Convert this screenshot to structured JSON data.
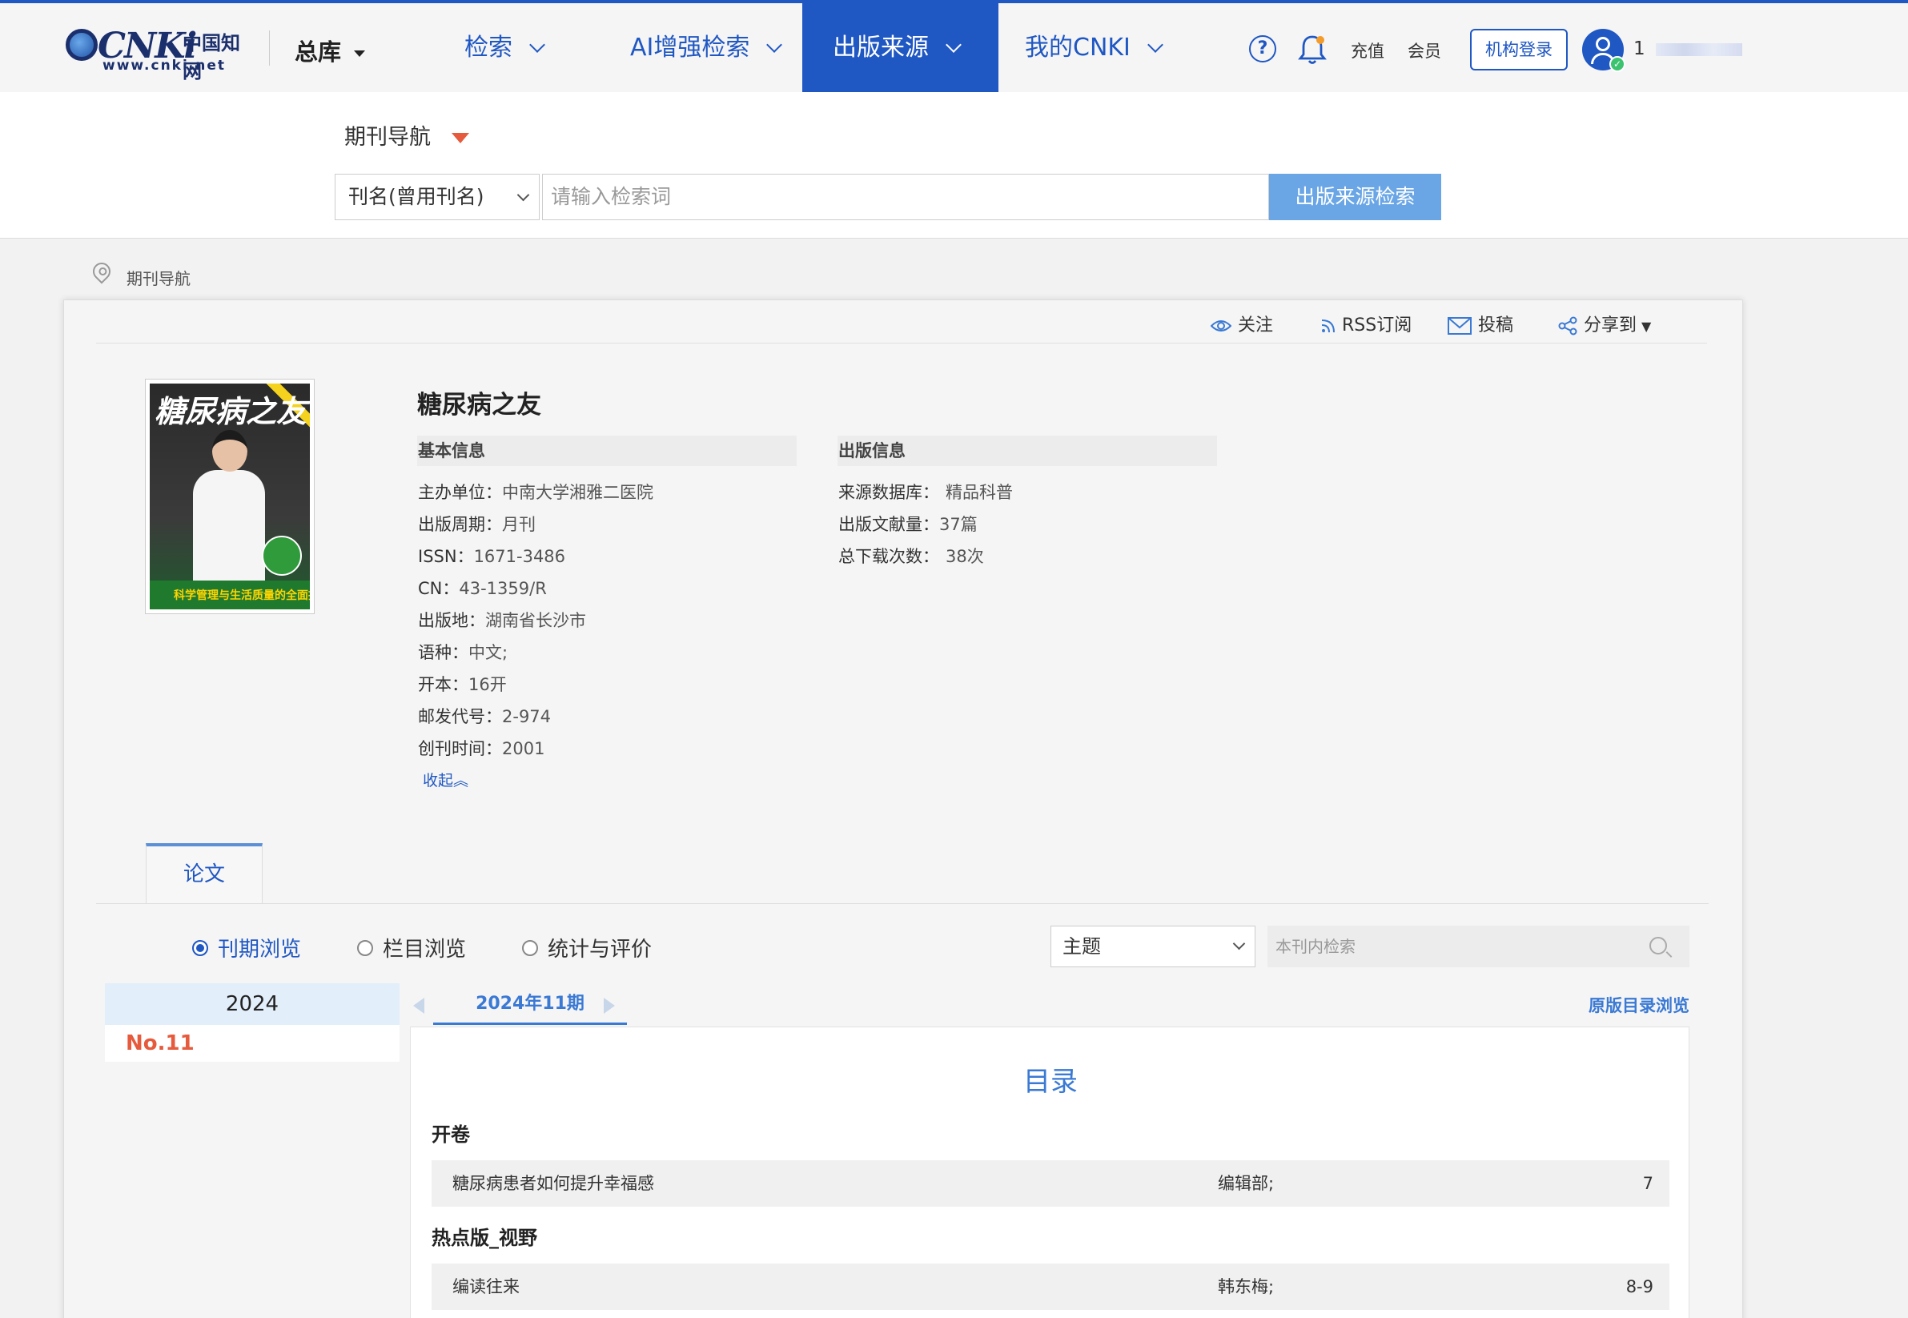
{
  "header": {
    "logo_text": "CNKi",
    "logo_cn": "中国知网",
    "logo_url": "www.cnki.net",
    "library_label": "总库",
    "nav": [
      {
        "label": "检索"
      },
      {
        "label": "AI增强检索"
      },
      {
        "label": "出版来源"
      },
      {
        "label": "我的CNKI"
      }
    ],
    "active_nav": "出版来源",
    "recharge_label": "充值",
    "member_label": "会员",
    "org_login_label": "机构登录",
    "user_name_prefix": "1"
  },
  "search": {
    "nav_label": "期刊导航",
    "field_select": "刊名(曾用刊名)",
    "placeholder": "请输入检索词",
    "button_label": "出版来源检索"
  },
  "breadcrumb": "期刊导航",
  "actions": {
    "follow": "关注",
    "rss": "RSS订阅",
    "submit": "投稿",
    "share": "分享到"
  },
  "journal": {
    "title": "糖尿病之友",
    "cover_title": "糖尿病之友",
    "cover_banner": "科学管理与生活质量的全面提升",
    "basic_info_heading": "基本信息",
    "publish_info_heading": "出版信息",
    "basic": [
      {
        "label": "主办单位：",
        "value": "中南大学湘雅二医院"
      },
      {
        "label": "出版周期：",
        "value": "月刊"
      },
      {
        "label": "ISSN：",
        "value": "1671-3486"
      },
      {
        "label": "CN：",
        "value": "43-1359/R"
      },
      {
        "label": "出版地：",
        "value": "湖南省长沙市"
      },
      {
        "label": "语种：",
        "value": "中文;"
      },
      {
        "label": "开本：",
        "value": "16开"
      },
      {
        "label": "邮发代号：",
        "value": "2-974"
      },
      {
        "label": "创刊时间：",
        "value": "2001"
      }
    ],
    "publish": [
      {
        "label": "来源数据库：",
        "value": "精品科普"
      },
      {
        "label": "出版文献量：",
        "value": "37篇"
      },
      {
        "label": "总下载次数：",
        "value": "38次"
      }
    ],
    "collapse_label": "收起︽"
  },
  "tabs": {
    "paper_tab": "论文",
    "radio": [
      {
        "label": "刊期浏览",
        "checked": true
      },
      {
        "label": "栏目浏览",
        "checked": false
      },
      {
        "label": "统计与评价",
        "checked": false
      }
    ],
    "topic_select": "主题",
    "inner_search_placeholder": "本刊内检索"
  },
  "issues": {
    "year": "2024",
    "issue_no": "No.11",
    "current_issue": "2024年11期",
    "original_toc_link": "原版目录浏览"
  },
  "toc": {
    "title": "目录",
    "sections": [
      {
        "name": "开卷",
        "rows": [
          {
            "title": "糖尿病患者如何提升幸福感",
            "author": "编辑部;",
            "pages": "7"
          }
        ]
      },
      {
        "name": "热点版_视野",
        "rows": [
          {
            "title": "编读往来",
            "author": "韩东梅;",
            "pages": "8-9"
          }
        ]
      }
    ]
  },
  "colors": {
    "brand_blue": "#1f57c3",
    "accent_orange": "#e65a3d",
    "link_blue": "#3a79d4"
  }
}
